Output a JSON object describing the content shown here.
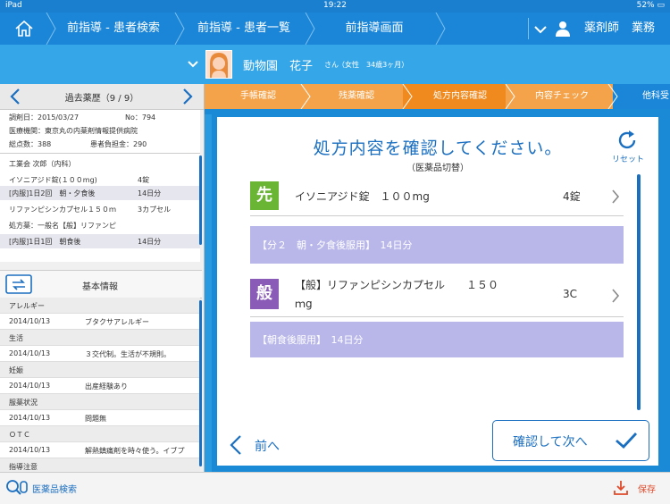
{
  "status": {
    "device": "iPad",
    "time": "19:22",
    "battery": "52%"
  },
  "nav": {
    "crumbs": [
      "前指導 - 患者検索",
      "前指導 - 患者一覧",
      "前指導画面"
    ],
    "role": "薬剤師",
    "menu": "業務"
  },
  "patient": {
    "name": "動物園　花子",
    "honorific": "さん",
    "details": "（女性　34歳3ヶ月）"
  },
  "history": {
    "title": "過去薬歴（9 / 9）",
    "date": "調剤日：2015/03/27",
    "no": "No：794",
    "facility": "医療機関：東京丸の内薬剤情報提供病院",
    "points": "総点数：388",
    "copay": "患者負担金：290",
    "doctor": "工業会 次郎（内科）",
    "rows": [
      {
        "text": "イソニアジド錠(１００mg)",
        "value": "4錠",
        "shade": false
      },
      {
        "text": "[内服]1日2回　朝・夕食後",
        "value": "14日分",
        "shade": true
      },
      {
        "text": "リファンピシンカプセル１５０ｍ",
        "value": "3カプセル",
        "shade": false
      },
      {
        "text": "処方薬：一般名【般】リファンピ",
        "value": "",
        "shade": false
      },
      {
        "text": "[内服]1日1回　朝食後",
        "value": "14日分",
        "shade": true
      }
    ]
  },
  "basic": {
    "title": "基本情報",
    "items": [
      {
        "type": "header",
        "text": "アレルギー"
      },
      {
        "type": "row",
        "date": "2014/10/13",
        "text": "ブタクサアレルギー"
      },
      {
        "type": "header",
        "text": "生活"
      },
      {
        "type": "row",
        "date": "2014/10/13",
        "text": "３交代制。生活が不規則。"
      },
      {
        "type": "header",
        "text": "妊娠"
      },
      {
        "type": "row",
        "date": "2014/10/13",
        "text": "出産経験あり"
      },
      {
        "type": "header",
        "text": "服薬状況"
      },
      {
        "type": "row",
        "date": "2014/10/13",
        "text": "問題無"
      },
      {
        "type": "header",
        "text": "ＯＴＣ"
      },
      {
        "type": "row",
        "date": "2014/10/13",
        "text": "解熱鎮痛剤を時々使う。イブプ"
      },
      {
        "type": "header",
        "text": "指導注意"
      }
    ]
  },
  "steps": [
    "手帳確認",
    "残薬確認",
    "処方内容確認",
    "内容チェック",
    "他科受"
  ],
  "main": {
    "title": "処方内容を確認してください。",
    "subtitle": "（医薬品切替）",
    "reset": "リセット",
    "drugs": [
      {
        "badge": "先",
        "name": "イソニアジド錠　１００mg",
        "qty": "4錠",
        "usage": "【分２　朝・夕食後服用】　14日分",
        "badge_color": "#6ab534"
      },
      {
        "badge": "般",
        "name1": "【般】リファンピシンカプセル　　１５０",
        "name2": "ｍg",
        "qty": "3C",
        "usage": "【朝食後服用】　14日分",
        "badge_color": "#8a5cb8"
      }
    ],
    "back": "前へ",
    "next": "確認して次へ"
  },
  "bottom": {
    "search": "医薬品検索",
    "save": "保存"
  }
}
